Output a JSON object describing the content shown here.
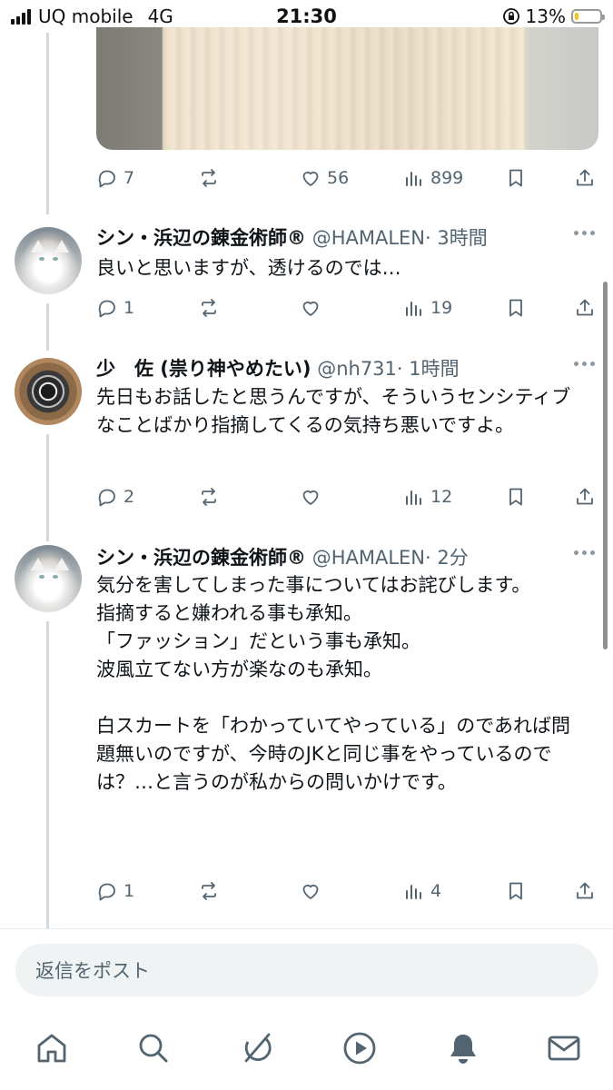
{
  "status_bar": {
    "carrier": "UQ mobile",
    "network": "4G",
    "time": "21:30",
    "battery_percent": "13%",
    "battery_level": 0.13,
    "icons": [
      "signal-icon",
      "orientation-lock-icon",
      "battery-icon"
    ]
  },
  "previous_tweet": {
    "media_alt": "",
    "actions": {
      "replies": "7",
      "retweets": "",
      "likes": "56",
      "views": "899"
    }
  },
  "tweets": [
    {
      "name": "シン・浜辺の錬金術師®",
      "handle": "@HAMALEN",
      "time": "· 3時間",
      "text": "良いと思いますが、透けるのでは…",
      "actions": {
        "replies": "1",
        "retweets": "",
        "likes": "",
        "views": "19"
      },
      "avatar": "white-cat-avatar"
    },
    {
      "name": "少　佐 (祟り神やめたい)",
      "handle": "@nh731",
      "time": "· 1時間",
      "text": "先日もお話したと思うんですが、そういうセンシティブなことばかり指摘してくるの気持ち悪いですよ。",
      "actions": {
        "replies": "2",
        "retweets": "",
        "likes": "",
        "views": "12"
      },
      "avatar": "bearing-avatar"
    },
    {
      "name": "シン・浜辺の錬金術師®",
      "handle": "@HAMALEN",
      "time": "· 2分",
      "text": "気分を害してしまった事についてはお詫びします。\n指摘すると嫌われる事も承知。\n「ファッション」だという事も承知。\n波風立てない方が楽なのも承知。\n\n白スカートを「わかっていてやっている」のであれば問題無いのですが、今時のJKと同じ事をやっているのでは？…と言うのが私からの問いかけです。",
      "actions": {
        "replies": "1",
        "retweets": "",
        "likes": "",
        "views": "4"
      },
      "avatar": "white-cat-avatar"
    }
  ],
  "reply_box": {
    "placeholder": "返信をポスト"
  },
  "tab_bar": {
    "items": [
      "home-icon",
      "search-icon",
      "grok-icon",
      "video-icon",
      "notifications-icon",
      "messages-icon"
    ]
  },
  "colors": {
    "text": "#0f1419",
    "secondary": "#536471",
    "thread_line": "#cfd9de",
    "reply_box_bg": "#eff3f4",
    "battery_fill": "#f5c518"
  }
}
